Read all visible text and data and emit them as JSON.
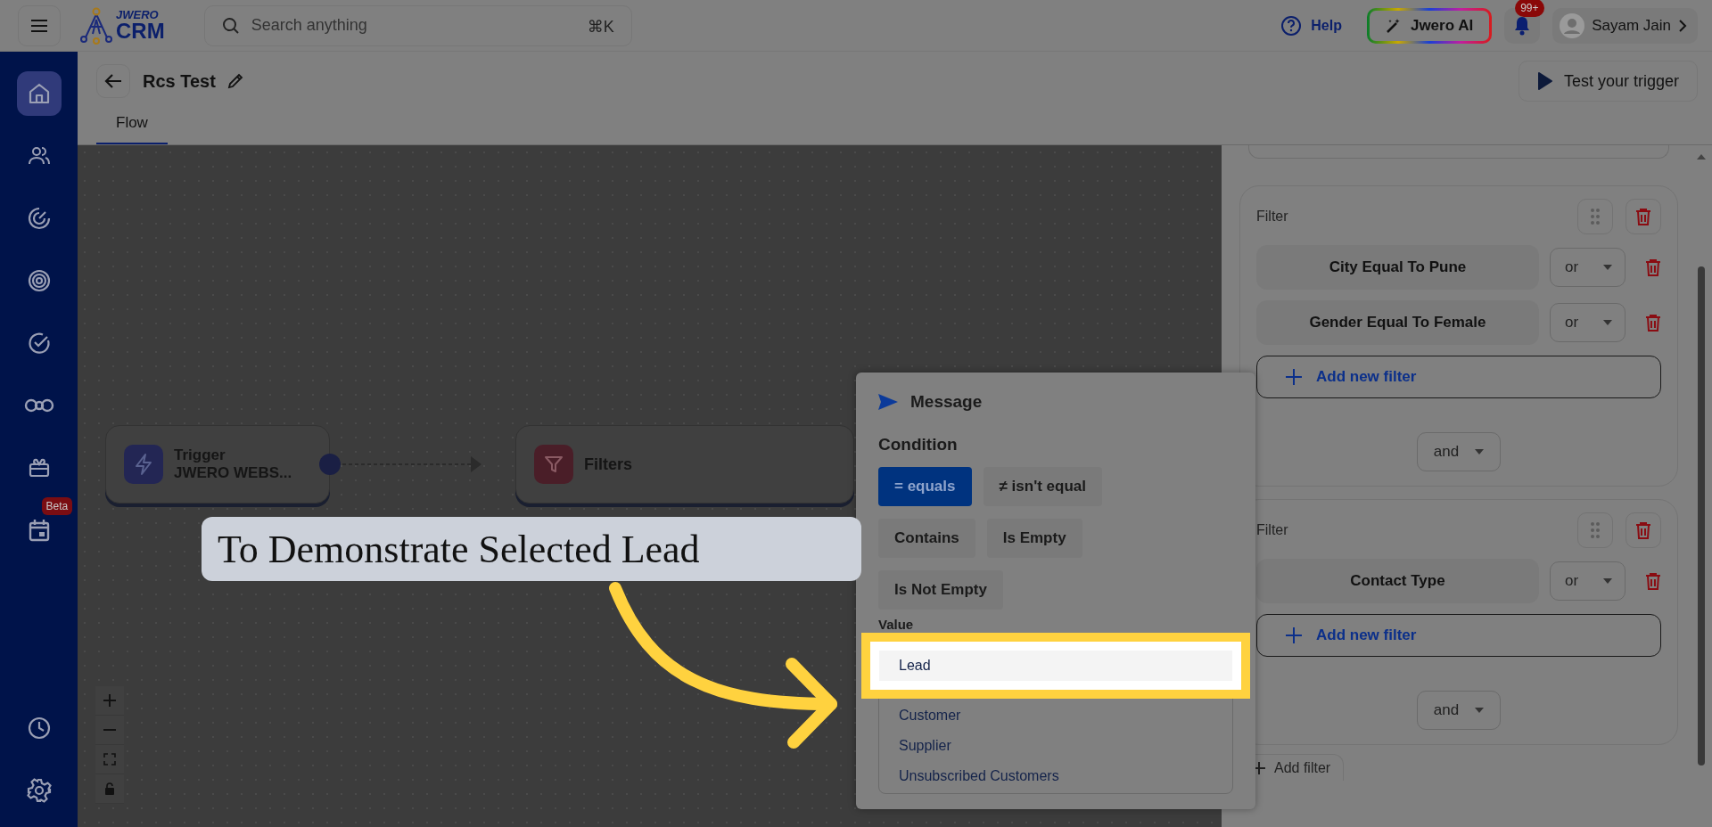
{
  "topbar": {
    "logo_top": "JWERO",
    "logo_bottom": "CRM",
    "search": {
      "placeholder": "Search anything",
      "shortcut": "⌘K"
    },
    "help": "Help",
    "ai_button": "Jwero AI",
    "notifications_badge": "99+",
    "user": "Sayam Jain"
  },
  "sidebar": {
    "top_items": [
      {
        "selected": true
      },
      {
        "selected": false
      },
      {
        "selected": false
      },
      {
        "selected": false
      },
      {
        "selected": false
      },
      {
        "selected": false
      },
      {
        "selected": false
      },
      {
        "selected": false,
        "badge": "Beta"
      }
    ],
    "bottom_items": [
      {
        "selected": false
      },
      {
        "selected": false
      }
    ]
  },
  "page": {
    "title": "Rcs Test",
    "test_button": "Test your trigger",
    "tabs": [
      {
        "label": "Flow",
        "selected": true
      }
    ]
  },
  "flow": {
    "nodes": [
      {
        "kind": "trigger",
        "title": "Trigger",
        "subtitle": "JWERO WEBS..."
      },
      {
        "kind": "filter",
        "title": "Filters"
      }
    ]
  },
  "popup": {
    "title": "Message",
    "condition_label": "Condition",
    "conditions": [
      {
        "label": "= equals",
        "selected": true
      },
      {
        "label": "≠ isn't equal",
        "selected": false
      },
      {
        "label": "Contains",
        "selected": false
      },
      {
        "label": "Is Empty",
        "selected": false
      },
      {
        "label": "Is Not Empty",
        "selected": false
      }
    ],
    "value_label": "Value",
    "options": [
      {
        "label": "Lead",
        "selected": true
      },
      {
        "label": "Customer",
        "selected": false
      },
      {
        "label": "Supplier",
        "selected": false
      },
      {
        "label": "Unsubscribed Customers",
        "selected": false
      }
    ]
  },
  "panel": {
    "filters": [
      {
        "title": "Filter",
        "conditions": [
          {
            "label": "City Equal To Pune",
            "joiner": "or"
          },
          {
            "label": "Gender Equal To Female",
            "joiner": "or"
          }
        ],
        "add_label": "Add new filter",
        "join": "and"
      },
      {
        "title": "Filter",
        "conditions": [
          {
            "label": "Contact Type",
            "joiner": "or"
          }
        ],
        "add_label": "Add new filter",
        "join": "and"
      }
    ],
    "add_filter": "Add filter"
  },
  "tutorial": {
    "callout": "To Demonstrate Selected Lead"
  }
}
